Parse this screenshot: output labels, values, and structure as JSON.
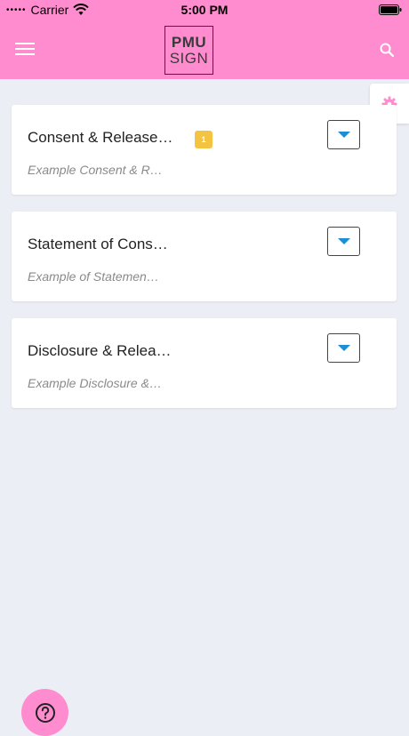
{
  "status_bar": {
    "carrier": "Carrier",
    "time": "5:00 PM"
  },
  "header": {
    "logo_top": "PMU",
    "logo_bottom": "SIGN",
    "accent_color": "#ff8ccf"
  },
  "icons": {
    "menu": "menu-icon",
    "search": "search-icon",
    "settings": "gear-icon",
    "dropdown": "caret-down-icon",
    "help": "question-circle-icon"
  },
  "forms": [
    {
      "title": "Consent & Release…",
      "subtitle": "Example Consent & R…",
      "badge": "1"
    },
    {
      "title": "Statement of Cons…",
      "subtitle": "Example of Statemen…"
    },
    {
      "title": "Disclosure & Relea…",
      "subtitle": "Example Disclosure &…"
    }
  ]
}
